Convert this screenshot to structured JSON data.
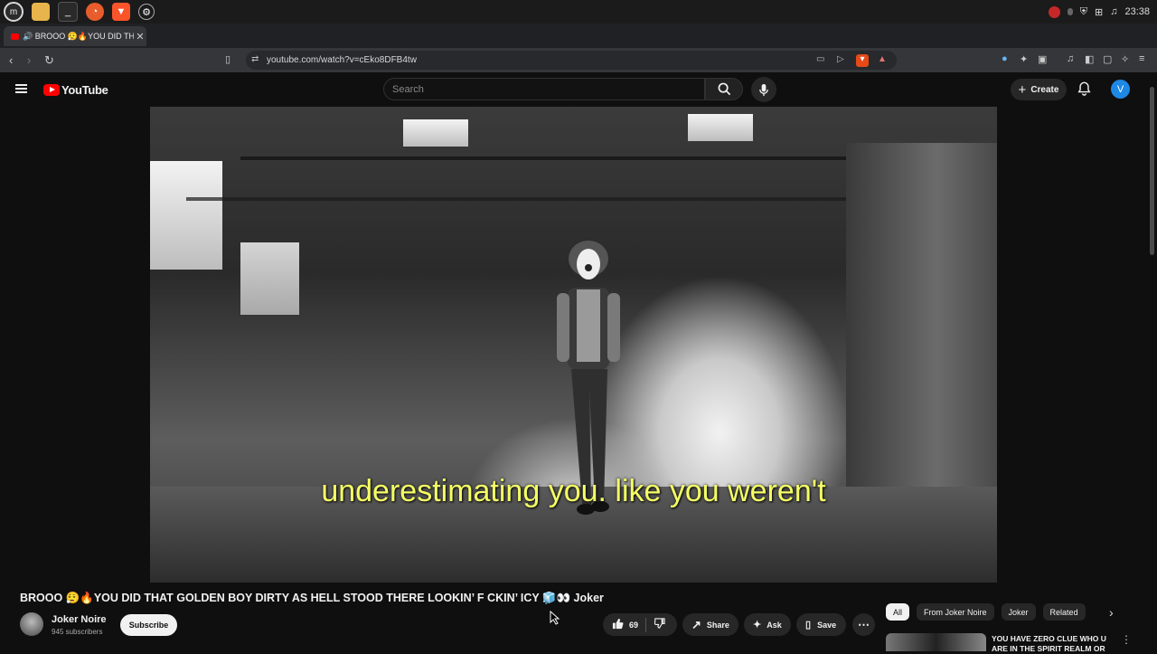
{
  "taskbar": {
    "clock": "23:38"
  },
  "browser": {
    "tab_title": "🔊 BROOO 😮‍💨🔥YOU DID TH",
    "new_tab": "+",
    "url": "youtube.com/watch?v=cEko8DFB4tw"
  },
  "youtube": {
    "logo_text": "YouTube",
    "search_placeholder": "Search",
    "create_label": "Create",
    "avatar_letter": "V"
  },
  "player": {
    "caption": "underestimating you. like you weren't"
  },
  "video": {
    "title": "BROOO 😮‍💨🔥YOU DID THAT GOLDEN BOY DIRTY AS HELL STOOD THERE LOOKIN’ F CKIN’ ICY 🧊👀 Joker",
    "channel_name": "Joker Noire",
    "subscribers": "945 subscribers",
    "subscribe_label": "Subscribe",
    "like_count": "69",
    "share_label": "Share",
    "ask_label": "Ask",
    "save_label": "Save"
  },
  "sidebar": {
    "chips": [
      "All",
      "From Joker Noire",
      "Joker",
      "Related"
    ],
    "rec_title": "YOU HAVE ZERO CLUE WHO U ARE IN THE SPIRIT REALM OR"
  }
}
